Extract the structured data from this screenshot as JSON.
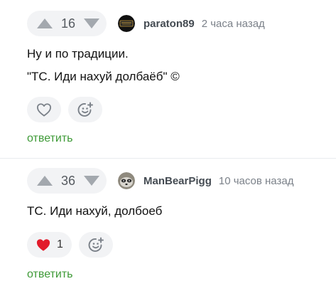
{
  "comments": [
    {
      "votes": "16",
      "username": "paraton89",
      "time": "2 часа назад",
      "lines": [
        "Ну и по традиции.",
        "\"ТС. Иди нахуй долбаёб\" ©"
      ],
      "liked": false,
      "like_count": "",
      "reply_label": "ответить",
      "avatar_icon": "dark-badge-avatar"
    },
    {
      "votes": "36",
      "username": "ManBearPigg",
      "time": "10 часов назад",
      "lines": [
        "ТС. Иди нахуй, долбоеб"
      ],
      "liked": true,
      "like_count": "1",
      "reply_label": "ответить",
      "avatar_icon": "raccoon-avatar"
    }
  ],
  "colors": {
    "accent_green": "#3e9a37",
    "like_red": "#e21b2b",
    "pill_bg": "#f2f3f5"
  }
}
